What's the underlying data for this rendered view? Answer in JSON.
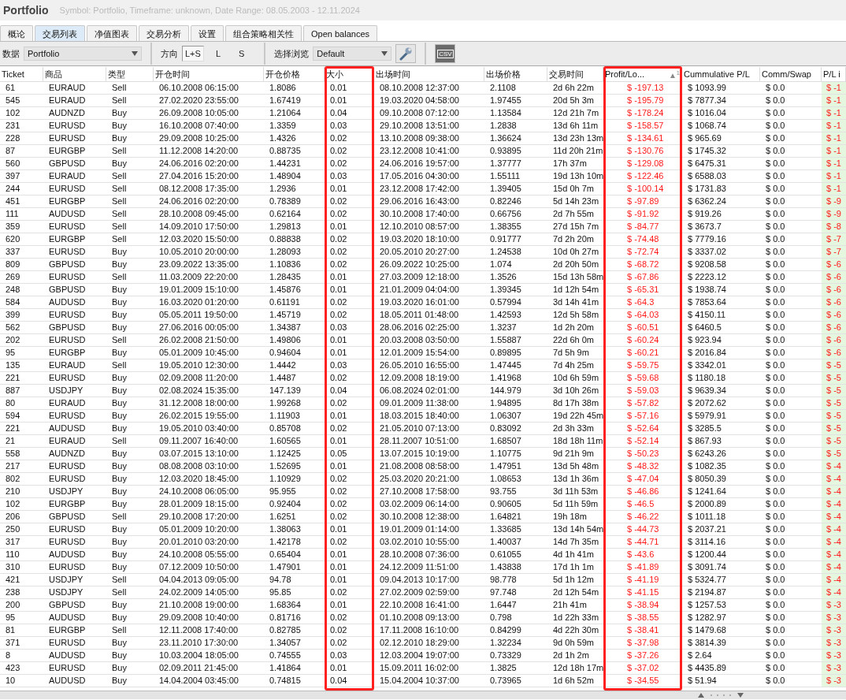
{
  "window": {
    "title": "Portfolio",
    "subtitle": "Symbol: Portfolio, Timeframe: unknown, Date Range: 08.05.2003 - 12.11.2024"
  },
  "tabs": [
    {
      "label": "概论",
      "selected": false
    },
    {
      "label": "交易列表",
      "selected": true
    },
    {
      "label": "净值图表",
      "selected": false
    },
    {
      "label": "交易分析",
      "selected": false
    },
    {
      "label": "设置",
      "selected": false
    },
    {
      "label": "组合策略相关性",
      "selected": false
    },
    {
      "label": "Open balances",
      "selected": false
    }
  ],
  "toolbar": {
    "data_label": "数据",
    "data_value": "Portfolio",
    "direction_label": "方向",
    "directions": [
      {
        "label": "L+S",
        "selected": true
      },
      {
        "label": "L",
        "selected": false
      },
      {
        "label": "S",
        "selected": false
      }
    ],
    "view_label": "选择浏览",
    "view_value": "Default",
    "csv_label": "CSV"
  },
  "table": {
    "columns": [
      {
        "label": "Ticket",
        "kind": "text",
        "highlighted": false
      },
      {
        "label": "商品",
        "kind": "text",
        "highlighted": false
      },
      {
        "label": "类型",
        "kind": "text",
        "highlighted": false
      },
      {
        "label": "开仓时间",
        "kind": "text",
        "highlighted": false
      },
      {
        "label": "开仓价格",
        "kind": "text",
        "highlighted": false
      },
      {
        "label": "大小",
        "kind": "text",
        "highlighted": true
      },
      {
        "label": "出场时间",
        "kind": "text",
        "highlighted": false
      },
      {
        "label": "出场价格",
        "kind": "text",
        "highlighted": false
      },
      {
        "label": "交易时间",
        "kind": "text",
        "highlighted": false
      },
      {
        "label": "Profit/Lo...",
        "kind": "loss",
        "highlighted": true,
        "sort_indicator": "▲",
        "sort_order": "1"
      },
      {
        "label": "Cummulative P/L",
        "kind": "text",
        "highlighted": false
      },
      {
        "label": "Comm/Swap",
        "kind": "text",
        "highlighted": false
      },
      {
        "label": "P/L i",
        "kind": "loss_shaded",
        "highlighted": false
      }
    ],
    "rows": [
      [
        "61",
        "EURAUD",
        "Sell",
        "06.10.2008 06:15:00",
        "1.8086",
        "0.01",
        "08.10.2008 12:37:00",
        "2.1108",
        "2d 6h 22m",
        "$ -197.13",
        "$ 1093.99",
        "$ 0.0",
        "$ -1"
      ],
      [
        "545",
        "EURAUD",
        "Sell",
        "27.02.2020 23:55:00",
        "1.67419",
        "0.01",
        "19.03.2020 04:58:00",
        "1.97455",
        "20d 5h 3m",
        "$ -195.79",
        "$ 7877.34",
        "$ 0.0",
        "$ -1"
      ],
      [
        "102",
        "AUDNZD",
        "Buy",
        "26.09.2008 10:05:00",
        "1.21064",
        "0.04",
        "09.10.2008 07:12:00",
        "1.13584",
        "12d 21h 7m",
        "$ -178.24",
        "$ 1016.04",
        "$ 0.0",
        "$ -1"
      ],
      [
        "231",
        "EURUSD",
        "Buy",
        "16.10.2008 07:40:00",
        "1.3359",
        "0.03",
        "29.10.2008 13:51:00",
        "1.2838",
        "13d 6h 11m",
        "$ -158.57",
        "$ 1068.74",
        "$ 0.0",
        "$ -1"
      ],
      [
        "228",
        "EURUSD",
        "Buy",
        "29.09.2008 10:25:00",
        "1.4326",
        "0.02",
        "13.10.2008 09:38:00",
        "1.36624",
        "13d 23h 13m",
        "$ -134.61",
        "$ 965.69",
        "$ 0.0",
        "$ -1"
      ],
      [
        "87",
        "EURGBP",
        "Sell",
        "11.12.2008 14:20:00",
        "0.88735",
        "0.02",
        "23.12.2008 10:41:00",
        "0.93895",
        "11d 20h 21m",
        "$ -130.76",
        "$ 1745.32",
        "$ 0.0",
        "$ -1"
      ],
      [
        "560",
        "GBPUSD",
        "Buy",
        "24.06.2016 02:20:00",
        "1.44231",
        "0.02",
        "24.06.2016 19:57:00",
        "1.37777",
        "17h 37m",
        "$ -129.08",
        "$ 6475.31",
        "$ 0.0",
        "$ -1"
      ],
      [
        "397",
        "EURAUD",
        "Sell",
        "27.04.2016 15:20:00",
        "1.48904",
        "0.03",
        "17.05.2016 04:30:00",
        "1.55111",
        "19d 13h 10m",
        "$ -122.46",
        "$ 6588.03",
        "$ 0.0",
        "$ -1"
      ],
      [
        "244",
        "EURUSD",
        "Sell",
        "08.12.2008 17:35:00",
        "1.2936",
        "0.01",
        "23.12.2008 17:42:00",
        "1.39405",
        "15d 0h 7m",
        "$ -100.14",
        "$ 1731.83",
        "$ 0.0",
        "$ -1"
      ],
      [
        "451",
        "EURGBP",
        "Sell",
        "24.06.2016 02:20:00",
        "0.78389",
        "0.02",
        "29.06.2016 16:43:00",
        "0.82246",
        "5d 14h 23m",
        "$ -97.89",
        "$ 6362.24",
        "$ 0.0",
        "$ -9"
      ],
      [
        "111",
        "AUDUSD",
        "Sell",
        "28.10.2008 09:45:00",
        "0.62164",
        "0.02",
        "30.10.2008 17:40:00",
        "0.66756",
        "2d 7h 55m",
        "$ -91.92",
        "$ 919.26",
        "$ 0.0",
        "$ -9"
      ],
      [
        "359",
        "EURUSD",
        "Sell",
        "14.09.2010 17:50:00",
        "1.29813",
        "0.01",
        "12.10.2010 08:57:00",
        "1.38355",
        "27d 15h 7m",
        "$ -84.77",
        "$ 3673.7",
        "$ 0.0",
        "$ -8"
      ],
      [
        "620",
        "EURGBP",
        "Sell",
        "12.03.2020 15:50:00",
        "0.88838",
        "0.02",
        "19.03.2020 18:10:00",
        "0.91777",
        "7d 2h 20m",
        "$ -74.48",
        "$ 7779.16",
        "$ 0.0",
        "$ -7"
      ],
      [
        "337",
        "EURUSD",
        "Buy",
        "10.05.2010 20:00:00",
        "1.28093",
        "0.02",
        "20.05.2010 20:27:00",
        "1.24538",
        "10d 0h 27m",
        "$ -72.74",
        "$ 3337.02",
        "$ 0.0",
        "$ -7"
      ],
      [
        "809",
        "GBPUSD",
        "Buy",
        "23.09.2022 13:35:00",
        "1.10836",
        "0.02",
        "26.09.2022 10:25:00",
        "1.074",
        "2d 20h 50m",
        "$ -68.72",
        "$ 9208.58",
        "$ 0.0",
        "$ -6"
      ],
      [
        "269",
        "EURUSD",
        "Sell",
        "11.03.2009 22:20:00",
        "1.28435",
        "0.01",
        "27.03.2009 12:18:00",
        "1.3526",
        "15d 13h 58m",
        "$ -67.86",
        "$ 2223.12",
        "$ 0.0",
        "$ -6"
      ],
      [
        "248",
        "GBPUSD",
        "Buy",
        "19.01.2009 15:10:00",
        "1.45876",
        "0.01",
        "21.01.2009 04:04:00",
        "1.39345",
        "1d 12h 54m",
        "$ -65.31",
        "$ 1938.74",
        "$ 0.0",
        "$ -6"
      ],
      [
        "584",
        "AUDUSD",
        "Buy",
        "16.03.2020 01:20:00",
        "0.61191",
        "0.02",
        "19.03.2020 16:01:00",
        "0.57994",
        "3d 14h 41m",
        "$ -64.3",
        "$ 7853.64",
        "$ 0.0",
        "$ -6"
      ],
      [
        "399",
        "EURUSD",
        "Buy",
        "05.05.2011 19:50:00",
        "1.45719",
        "0.02",
        "18.05.2011 01:48:00",
        "1.42593",
        "12d 5h 58m",
        "$ -64.03",
        "$ 4150.11",
        "$ 0.0",
        "$ -6"
      ],
      [
        "562",
        "GBPUSD",
        "Buy",
        "27.06.2016 00:05:00",
        "1.34387",
        "0.03",
        "28.06.2016 02:25:00",
        "1.3237",
        "1d 2h 20m",
        "$ -60.51",
        "$ 6460.5",
        "$ 0.0",
        "$ -6"
      ],
      [
        "202",
        "EURUSD",
        "Sell",
        "26.02.2008 21:50:00",
        "1.49806",
        "0.01",
        "20.03.2008 03:50:00",
        "1.55887",
        "22d 6h 0m",
        "$ -60.24",
        "$ 923.94",
        "$ 0.0",
        "$ -6"
      ],
      [
        "95",
        "EURGBP",
        "Buy",
        "05.01.2009 10:45:00",
        "0.94604",
        "0.01",
        "12.01.2009 15:54:00",
        "0.89895",
        "7d 5h 9m",
        "$ -60.21",
        "$ 2016.84",
        "$ 0.0",
        "$ -6"
      ],
      [
        "135",
        "EURAUD",
        "Sell",
        "19.05.2010 12:30:00",
        "1.4442",
        "0.03",
        "26.05.2010 16:55:00",
        "1.47445",
        "7d 4h 25m",
        "$ -59.75",
        "$ 3342.01",
        "$ 0.0",
        "$ -5"
      ],
      [
        "221",
        "EURUSD",
        "Buy",
        "02.09.2008 11:20:00",
        "1.4487",
        "0.02",
        "12.09.2008 18:19:00",
        "1.41968",
        "10d 6h 59m",
        "$ -59.68",
        "$ 1180.18",
        "$ 0.0",
        "$ -5"
      ],
      [
        "887",
        "USDJPY",
        "Buy",
        "02.08.2024 15:35:00",
        "147.139",
        "0.04",
        "06.08.2024 02:01:00",
        "144.979",
        "3d 10h 26m",
        "$ -59.03",
        "$ 9639.34",
        "$ 0.0",
        "$ -5"
      ],
      [
        "80",
        "EURAUD",
        "Buy",
        "31.12.2008 18:00:00",
        "1.99268",
        "0.02",
        "09.01.2009 11:38:00",
        "1.94895",
        "8d 17h 38m",
        "$ -57.82",
        "$ 2072.62",
        "$ 0.0",
        "$ -5"
      ],
      [
        "594",
        "EURUSD",
        "Buy",
        "26.02.2015 19:55:00",
        "1.11903",
        "0.01",
        "18.03.2015 18:40:00",
        "1.06307",
        "19d 22h 45m",
        "$ -57.16",
        "$ 5979.91",
        "$ 0.0",
        "$ -5"
      ],
      [
        "221",
        "AUDUSD",
        "Buy",
        "19.05.2010 03:40:00",
        "0.85708",
        "0.02",
        "21.05.2010 07:13:00",
        "0.83092",
        "2d 3h 33m",
        "$ -52.64",
        "$ 3285.5",
        "$ 0.0",
        "$ -5"
      ],
      [
        "21",
        "EURAUD",
        "Sell",
        "09.11.2007 16:40:00",
        "1.60565",
        "0.01",
        "28.11.2007 10:51:00",
        "1.68507",
        "18d 18h 11m",
        "$ -52.14",
        "$ 867.93",
        "$ 0.0",
        "$ -5"
      ],
      [
        "558",
        "AUDNZD",
        "Buy",
        "03.07.2015 13:10:00",
        "1.12425",
        "0.05",
        "13.07.2015 10:19:00",
        "1.10775",
        "9d 21h 9m",
        "$ -50.23",
        "$ 6243.26",
        "$ 0.0",
        "$ -5"
      ],
      [
        "217",
        "EURUSD",
        "Buy",
        "08.08.2008 03:10:00",
        "1.52695",
        "0.01",
        "21.08.2008 08:58:00",
        "1.47951",
        "13d 5h 48m",
        "$ -48.32",
        "$ 1082.35",
        "$ 0.0",
        "$ -4"
      ],
      [
        "802",
        "EURUSD",
        "Buy",
        "12.03.2020 18:45:00",
        "1.10929",
        "0.02",
        "25.03.2020 20:21:00",
        "1.08653",
        "13d 1h 36m",
        "$ -47.04",
        "$ 8050.39",
        "$ 0.0",
        "$ -4"
      ],
      [
        "210",
        "USDJPY",
        "Buy",
        "24.10.2008 06:05:00",
        "95.955",
        "0.02",
        "27.10.2008 17:58:00",
        "93.755",
        "3d 11h 53m",
        "$ -46.86",
        "$ 1241.64",
        "$ 0.0",
        "$ -4"
      ],
      [
        "102",
        "EURGBP",
        "Buy",
        "28.01.2009 18:15:00",
        "0.92404",
        "0.02",
        "03.02.2009 06:14:00",
        "0.90605",
        "5d 11h 59m",
        "$ -46.5",
        "$ 2000.89",
        "$ 0.0",
        "$ -4"
      ],
      [
        "206",
        "GBPUSD",
        "Sell",
        "29.10.2008 17:20:00",
        "1.6251",
        "0.02",
        "30.10.2008 12:38:00",
        "1.64821",
        "19h 18m",
        "$ -46.22",
        "$ 1011.18",
        "$ 0.0",
        "$ -4"
      ],
      [
        "250",
        "EURUSD",
        "Buy",
        "05.01.2009 10:20:00",
        "1.38063",
        "0.01",
        "19.01.2009 01:14:00",
        "1.33685",
        "13d 14h 54m",
        "$ -44.73",
        "$ 2037.21",
        "$ 0.0",
        "$ -4"
      ],
      [
        "317",
        "EURUSD",
        "Buy",
        "20.01.2010 03:20:00",
        "1.42178",
        "0.02",
        "03.02.2010 10:55:00",
        "1.40037",
        "14d 7h 35m",
        "$ -44.71",
        "$ 3114.16",
        "$ 0.0",
        "$ -4"
      ],
      [
        "110",
        "AUDUSD",
        "Buy",
        "24.10.2008 05:55:00",
        "0.65404",
        "0.01",
        "28.10.2008 07:36:00",
        "0.61055",
        "4d 1h 41m",
        "$ -43.6",
        "$ 1200.44",
        "$ 0.0",
        "$ -4"
      ],
      [
        "310",
        "EURUSD",
        "Buy",
        "07.12.2009 10:50:00",
        "1.47901",
        "0.01",
        "24.12.2009 11:51:00",
        "1.43838",
        "17d 1h 1m",
        "$ -41.89",
        "$ 3091.74",
        "$ 0.0",
        "$ -4"
      ],
      [
        "421",
        "USDJPY",
        "Sell",
        "04.04.2013 09:05:00",
        "94.78",
        "0.01",
        "09.04.2013 10:17:00",
        "98.778",
        "5d 1h 12m",
        "$ -41.19",
        "$ 5324.77",
        "$ 0.0",
        "$ -4"
      ],
      [
        "238",
        "USDJPY",
        "Sell",
        "24.02.2009 14:05:00",
        "95.85",
        "0.02",
        "27.02.2009 02:59:00",
        "97.748",
        "2d 12h 54m",
        "$ -41.15",
        "$ 2194.87",
        "$ 0.0",
        "$ -4"
      ],
      [
        "200",
        "GBPUSD",
        "Buy",
        "21.10.2008 19:00:00",
        "1.68364",
        "0.01",
        "22.10.2008 16:41:00",
        "1.6447",
        "21h 41m",
        "$ -38.94",
        "$ 1257.53",
        "$ 0.0",
        "$ -3"
      ],
      [
        "95",
        "AUDUSD",
        "Buy",
        "29.09.2008 10:40:00",
        "0.81716",
        "0.02",
        "01.10.2008 09:13:00",
        "0.798",
        "1d 22h 33m",
        "$ -38.55",
        "$ 1282.97",
        "$ 0.0",
        "$ -3"
      ],
      [
        "81",
        "EURGBP",
        "Sell",
        "12.11.2008 17:40:00",
        "0.82785",
        "0.02",
        "17.11.2008 16:10:00",
        "0.84299",
        "4d 22h 30m",
        "$ -38.41",
        "$ 1479.68",
        "$ 0.0",
        "$ -3"
      ],
      [
        "371",
        "EURUSD",
        "Buy",
        "23.11.2010 17:30:00",
        "1.34057",
        "0.02",
        "02.12.2010 18:29:00",
        "1.32234",
        "9d 0h 59m",
        "$ -37.98",
        "$ 3814.39",
        "$ 0.0",
        "$ -3"
      ],
      [
        "8",
        "AUDUSD",
        "Buy",
        "10.03.2004 18:05:00",
        "0.74555",
        "0.03",
        "12.03.2004 19:07:00",
        "0.73329",
        "2d 1h 2m",
        "$ -37.26",
        "$ 2.64",
        "$ 0.0",
        "$ -3"
      ],
      [
        "423",
        "EURUSD",
        "Buy",
        "02.09.2011 21:45:00",
        "1.41864",
        "0.01",
        "15.09.2011 16:02:00",
        "1.3825",
        "12d 18h 17m",
        "$ -37.02",
        "$ 4435.89",
        "$ 0.0",
        "$ -3"
      ],
      [
        "10",
        "AUDUSD",
        "Buy",
        "14.04.2004 03:45:00",
        "0.74815",
        "0.04",
        "15.04.2004 10:37:00",
        "0.73965",
        "1d 6h 52m",
        "$ -34.55",
        "$ 51.94",
        "$ 0.0",
        "$ -3"
      ]
    ]
  }
}
